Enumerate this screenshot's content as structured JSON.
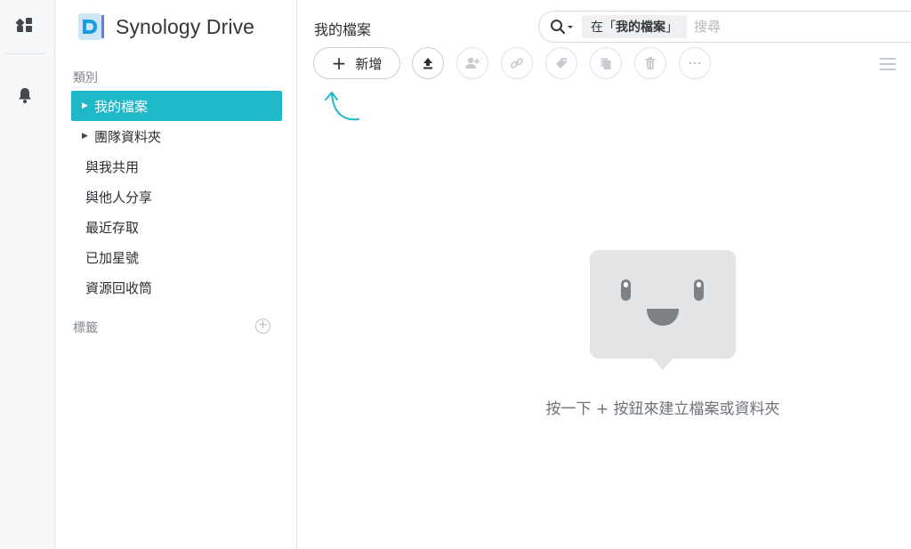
{
  "app": {
    "name": "Synology Drive"
  },
  "rail": {
    "items": [
      "dashboard-icon",
      "bell-icon"
    ]
  },
  "sidebar": {
    "categories_title": "類別",
    "items": [
      {
        "label": "我的檔案",
        "has_caret": true,
        "active": true
      },
      {
        "label": "團隊資料夾",
        "has_caret": true,
        "active": false
      },
      {
        "label": "與我共用",
        "has_caret": false,
        "active": false
      },
      {
        "label": "與他人分享",
        "has_caret": false,
        "active": false
      },
      {
        "label": "最近存取",
        "has_caret": false,
        "active": false
      },
      {
        "label": "已加星號",
        "has_caret": false,
        "active": false
      },
      {
        "label": "資源回收筒",
        "has_caret": false,
        "active": false
      }
    ],
    "tags_title": "標籤"
  },
  "main": {
    "title": "我的檔案",
    "search": {
      "scope_prefix": "在「",
      "scope_name": "我的檔案",
      "scope_suffix": "」",
      "placeholder": "搜尋"
    },
    "toolbar": {
      "new_label": "新增",
      "buttons": [
        "upload-icon",
        "add-member-icon",
        "link-icon",
        "tag-icon",
        "copy-icon",
        "trash-icon",
        "more-icon"
      ]
    },
    "empty_message": "按一下 + 按鈕來建立檔案或資料夾"
  },
  "colors": {
    "accent": "#1fb8c8",
    "empty_face": "#e2e4e6"
  }
}
